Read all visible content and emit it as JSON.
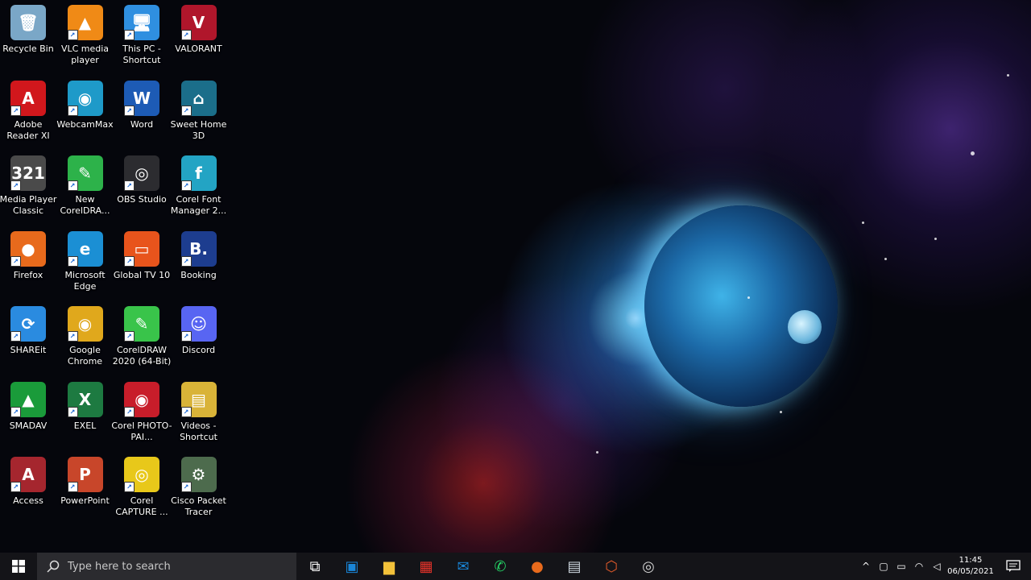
{
  "desktop": {
    "icons": [
      {
        "label": "Recycle Bin",
        "glyph": "🗑",
        "bg": "#7aa7c7"
      },
      {
        "label": "VLC media player",
        "glyph": "▲",
        "bg": "#f08a16"
      },
      {
        "label": "This PC - Shortcut",
        "glyph": "🖥",
        "bg": "#2f8fe0"
      },
      {
        "label": "VALORANT",
        "glyph": "V",
        "bg": "#b0162b"
      },
      {
        "label": "Adobe Reader XI",
        "glyph": "A",
        "bg": "#d1171c"
      },
      {
        "label": "WebcamMax",
        "glyph": "◉",
        "bg": "#1e9ac9"
      },
      {
        "label": "Word",
        "glyph": "W",
        "bg": "#1d5bb5"
      },
      {
        "label": "Sweet Home 3D",
        "glyph": "⌂",
        "bg": "#1b6e8a"
      },
      {
        "label": "Media Player Classic",
        "glyph": "321",
        "bg": "#4a4a4a"
      },
      {
        "label": "New CorelDRA...",
        "glyph": "✎",
        "bg": "#2db24a"
      },
      {
        "label": "OBS Studio",
        "glyph": "◎",
        "bg": "#2c2c30"
      },
      {
        "label": "Corel Font Manager 2...",
        "glyph": "f",
        "bg": "#23a4c4"
      },
      {
        "label": "Firefox",
        "glyph": "●",
        "bg": "#e86a1c"
      },
      {
        "label": "Microsoft Edge",
        "glyph": "e",
        "bg": "#1b8fd4"
      },
      {
        "label": "Global TV 10",
        "glyph": "▭",
        "bg": "#e8541c"
      },
      {
        "label": "Booking",
        "glyph": "B.",
        "bg": "#1d3d8f"
      },
      {
        "label": "SHAREit",
        "glyph": "⟳",
        "bg": "#2a8be0"
      },
      {
        "label": "Google Chrome",
        "glyph": "◉",
        "bg": "#e0a81c"
      },
      {
        "label": "CorelDRAW 2020 (64-Bit)",
        "glyph": "✎",
        "bg": "#39c44a"
      },
      {
        "label": "Discord",
        "glyph": "☺",
        "bg": "#5865f2"
      },
      {
        "label": "SMADAV",
        "glyph": "▲",
        "bg": "#1a9b3a"
      },
      {
        "label": "EXEL",
        "glyph": "X",
        "bg": "#1d7a41"
      },
      {
        "label": "Corel PHOTO-PAI...",
        "glyph": "◉",
        "bg": "#c81d2a"
      },
      {
        "label": "Videos - Shortcut",
        "glyph": "▤",
        "bg": "#d9b338"
      },
      {
        "label": "Access",
        "glyph": "A",
        "bg": "#a5262e"
      },
      {
        "label": "PowerPoint",
        "glyph": "P",
        "bg": "#c8462a"
      },
      {
        "label": "Corel CAPTURE ...",
        "glyph": "◎",
        "bg": "#e8c81a"
      },
      {
        "label": "Cisco Packet Tracer",
        "glyph": "⚙",
        "bg": "#4d6b4d"
      }
    ]
  },
  "taskbar": {
    "search_placeholder": "Type here to search",
    "clock_time": "11:45",
    "clock_date": "06/05/2021",
    "apps": [
      {
        "name": "task-view-icon",
        "glyph": "⧉",
        "color": "#ffffff"
      },
      {
        "name": "store-icon",
        "glyph": "▣",
        "color": "#1a86d8"
      },
      {
        "name": "file-explorer-icon",
        "glyph": "▆",
        "color": "#f2c13a"
      },
      {
        "name": "gift-icon",
        "glyph": "▦",
        "color": "#e8332a"
      },
      {
        "name": "mail-icon",
        "glyph": "✉",
        "color": "#1a86d8"
      },
      {
        "name": "whatsapp-icon",
        "glyph": "✆",
        "color": "#25d366"
      },
      {
        "name": "firefox-icon",
        "glyph": "●",
        "color": "#e86a1c"
      },
      {
        "name": "folder-icon",
        "glyph": "▤",
        "color": "#cfd8e0"
      },
      {
        "name": "security-icon",
        "glyph": "⬡",
        "color": "#e05a2a"
      },
      {
        "name": "obs-icon",
        "glyph": "◎",
        "color": "#d0d0d0"
      }
    ],
    "tray": [
      {
        "name": "chevron-up-icon",
        "glyph": "^"
      },
      {
        "name": "meet-now-icon",
        "glyph": "▢"
      },
      {
        "name": "battery-icon",
        "glyph": "▭"
      },
      {
        "name": "wifi-icon",
        "glyph": "◠"
      },
      {
        "name": "volume-icon",
        "glyph": "◁"
      }
    ]
  }
}
